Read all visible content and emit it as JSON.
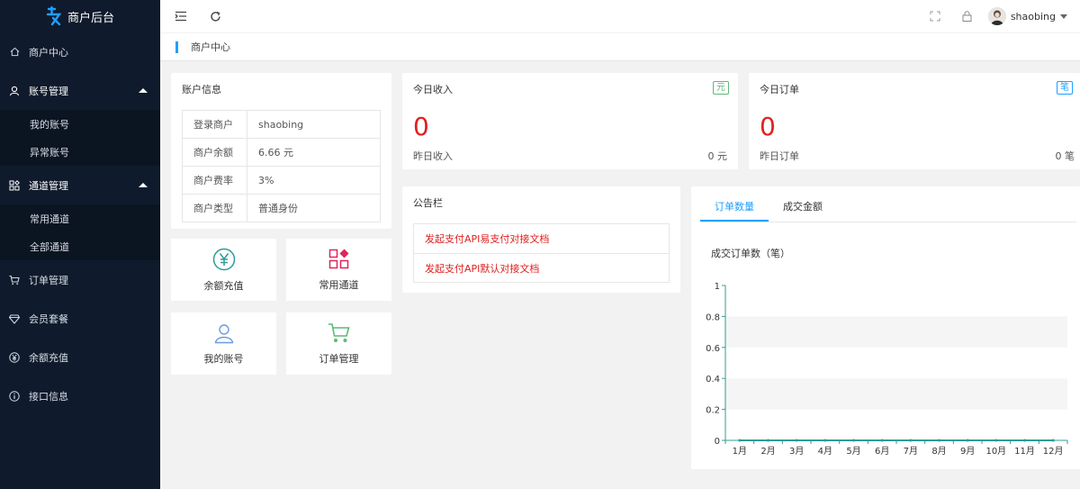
{
  "sidebar": {
    "brand": "商户后台",
    "items": [
      {
        "label": "商户中心",
        "icon": "home-icon"
      },
      {
        "label": "账号管理",
        "icon": "user-icon",
        "open": true,
        "children": [
          "我的账号",
          "异常账号"
        ]
      },
      {
        "label": "通道管理",
        "icon": "apps-icon",
        "open": true,
        "children": [
          "常用通道",
          "全部通道"
        ]
      },
      {
        "label": "订单管理",
        "icon": "cart-icon"
      },
      {
        "label": "会员套餐",
        "icon": "diamond-icon"
      },
      {
        "label": "余额充值",
        "icon": "yen-icon"
      },
      {
        "label": "接口信息",
        "icon": "info-icon"
      }
    ]
  },
  "header": {
    "username": "shaobing"
  },
  "breadcrumb": {
    "current": "商户中心"
  },
  "account": {
    "title": "账户信息",
    "rows": [
      {
        "label": "登录商户",
        "value": "shaobing"
      },
      {
        "label": "商户余额",
        "value": "6.66 元"
      },
      {
        "label": "商户费率",
        "value": "3%"
      },
      {
        "label": "商户类型",
        "value": "普通身份"
      }
    ]
  },
  "tiles": [
    {
      "label": "余额充值",
      "icon": "yen-circle-icon"
    },
    {
      "label": "常用通道",
      "icon": "apps-grid-icon"
    },
    {
      "label": "我的账号",
      "icon": "user-icon"
    },
    {
      "label": "订单管理",
      "icon": "cart-icon"
    }
  ],
  "income": {
    "title": "今日收入",
    "badge": "元",
    "value": "0",
    "foot_label": "昨日收入",
    "foot_value": "0 元"
  },
  "orders": {
    "title": "今日订单",
    "badge": "笔",
    "value": "0",
    "foot_label": "昨日订单",
    "foot_value": "0 笔"
  },
  "notice": {
    "title": "公告栏",
    "items": [
      "发起支付API易支付对接文档",
      "发起支付API默认对接文档"
    ]
  },
  "chart_tabs": [
    "订单数量",
    "成交金额"
  ],
  "colors": {
    "sidebar_bg": "#0f1b2c",
    "accent": "#1e9fff",
    "red": "#e02020",
    "green": "#5fb878",
    "line": "#2f9c95"
  },
  "chart_data": {
    "type": "line",
    "title": "成交订单数（笔）",
    "categories": [
      "1月",
      "2月",
      "3月",
      "4月",
      "5月",
      "6月",
      "7月",
      "8月",
      "9月",
      "10月",
      "11月",
      "12月"
    ],
    "series": [
      {
        "values": [
          0,
          0,
          0,
          0,
          0,
          0,
          0,
          0,
          0,
          0,
          0,
          0
        ]
      }
    ],
    "ylim": [
      0,
      1
    ],
    "yticks": [
      "0",
      "0.2",
      "0.4",
      "0.6",
      "0.8",
      "1"
    ]
  }
}
